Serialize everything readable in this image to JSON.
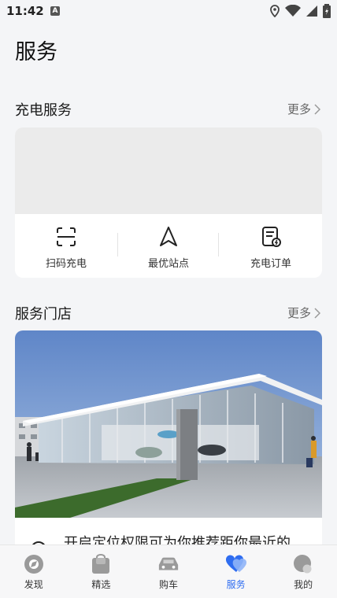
{
  "status": {
    "time": "11:42",
    "notif_letter": "A"
  },
  "page": {
    "title": "服务"
  },
  "charging": {
    "title": "充电服务",
    "more": "更多",
    "actions": [
      {
        "label": "扫码充电",
        "icon": "scan-icon"
      },
      {
        "label": "最优站点",
        "icon": "navigation-icon"
      },
      {
        "label": "充电订单",
        "icon": "order-icon"
      }
    ]
  },
  "stores": {
    "title": "服务门店",
    "more": "更多",
    "hint": "开启定位权限可为你推荐距你最近的"
  },
  "tabs": [
    {
      "label": "发现",
      "icon": "discover-icon",
      "active": false
    },
    {
      "label": "精选",
      "icon": "shopping-bag-icon",
      "active": false
    },
    {
      "label": "购车",
      "icon": "car-icon",
      "active": false
    },
    {
      "label": "服务",
      "icon": "heart-icon",
      "active": true
    },
    {
      "label": "我的",
      "icon": "profile-icon",
      "active": false
    }
  ],
  "colors": {
    "accent": "#2f6df0",
    "background": "#f4f5f7"
  }
}
